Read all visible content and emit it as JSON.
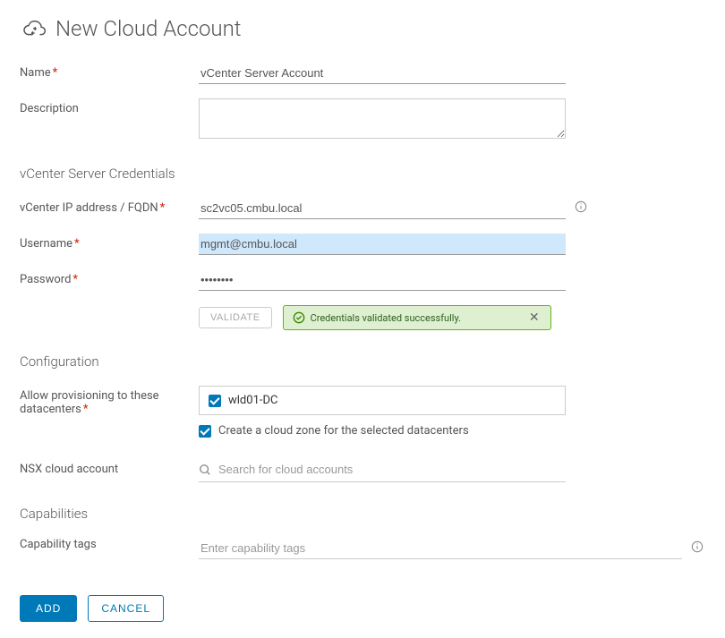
{
  "header": {
    "title": "New Cloud Account"
  },
  "fields": {
    "name": {
      "label": "Name",
      "value": "vCenter Server Account"
    },
    "description": {
      "label": "Description",
      "value": ""
    }
  },
  "credentials": {
    "section_title": "vCenter Server Credentials",
    "ip": {
      "label": "vCenter IP address / FQDN",
      "value": "sc2vc05.cmbu.local"
    },
    "username": {
      "label": "Username",
      "value": "mgmt@cmbu.local"
    },
    "password": {
      "label": "Password",
      "value": "••••••••"
    },
    "validate_label": "VALIDATE",
    "success_message": "Credentials validated successfully."
  },
  "configuration": {
    "section_title": "Configuration",
    "provision": {
      "label": "Allow provisioning to these datacenters",
      "datacenter": "wld01-DC"
    },
    "create_zone_label": "Create a cloud zone for the selected datacenters",
    "nsx": {
      "label": "NSX cloud account",
      "placeholder": "Search for cloud accounts"
    }
  },
  "capabilities": {
    "section_title": "Capabilities",
    "tags": {
      "label": "Capability tags",
      "placeholder": "Enter capability tags"
    }
  },
  "footer": {
    "add": "ADD",
    "cancel": "CANCEL"
  }
}
